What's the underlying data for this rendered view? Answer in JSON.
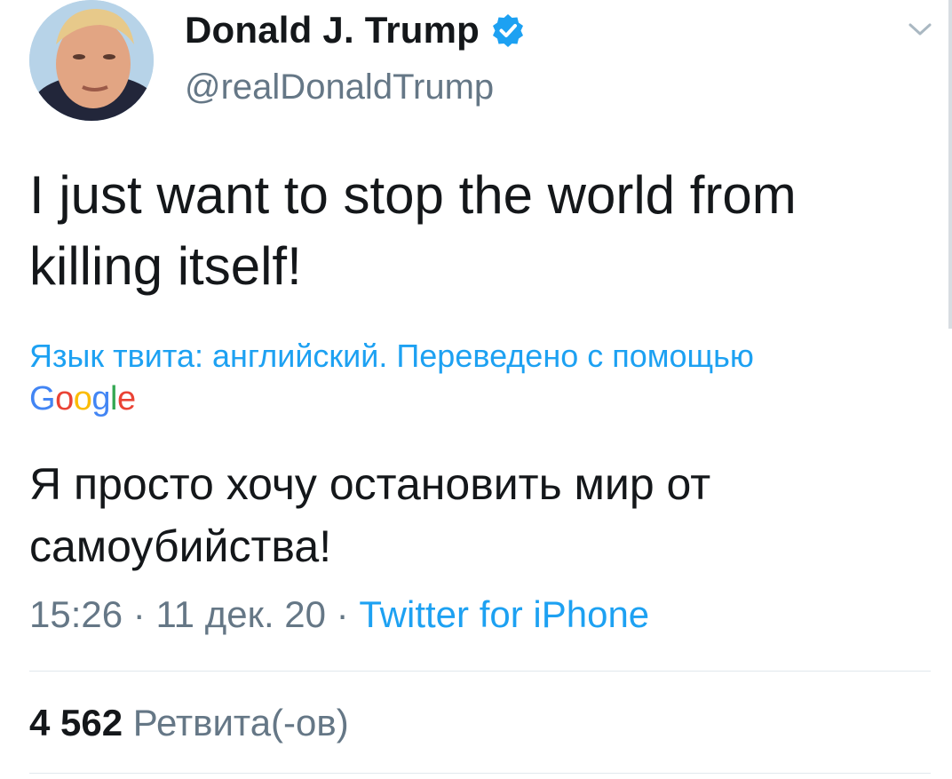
{
  "author": {
    "display_name": "Donald J. Trump",
    "handle": "@realDonaldTrump",
    "verified": true,
    "avatar_icon": "profile-photo"
  },
  "tweet": {
    "text": "I just want to stop the world from killing itself!"
  },
  "translation": {
    "label": "Язык твита: английский. Переведено с помощью",
    "provider_logo": [
      "G",
      "o",
      "o",
      "g",
      "l",
      "e"
    ],
    "provider_colors": [
      "#4285F4",
      "#EA4335",
      "#FBBC05",
      "#4285F4",
      "#34A853",
      "#EA4335"
    ],
    "text": "Я просто хочу остановить мир от самоубийства!"
  },
  "meta": {
    "time": "15:26",
    "date": "11 дек. 20",
    "separator": " · ",
    "source": "Twitter for iPhone"
  },
  "stats": {
    "retweet_count": "4 562",
    "retweet_label": "Ретвита(-ов)"
  },
  "colors": {
    "accent": "#1da1f2",
    "secondary_text": "#657786",
    "primary_text": "#14171a",
    "divider": "#e1e8ed"
  },
  "icons": {
    "verified": "verified-badge-icon",
    "menu": "chevron-down-icon"
  }
}
